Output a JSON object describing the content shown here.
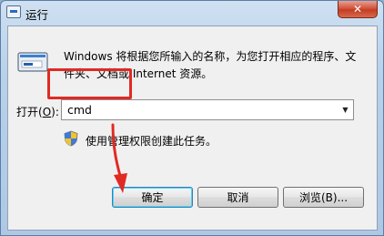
{
  "window": {
    "title": "运行",
    "close_glyph": "✕"
  },
  "body": {
    "description": "Windows 将根据您所输入的名称，为您打开相应的程序、文件夹、文档或 Internet 资源。",
    "open_label_prefix": "打开(",
    "open_label_key": "O",
    "open_label_suffix": "):",
    "input_value": "cmd",
    "admin_note": "使用管理权限创建此任务。"
  },
  "buttons": {
    "ok": "确定",
    "cancel": "取消",
    "browse": "浏览(B)..."
  },
  "annotation": {
    "highlight_color": "#e02a24"
  },
  "icons": {
    "title": "run-app-icon",
    "run": "run-program-icon",
    "shield": "uac-shield-icon",
    "dropdown": "chevron-down-icon"
  }
}
